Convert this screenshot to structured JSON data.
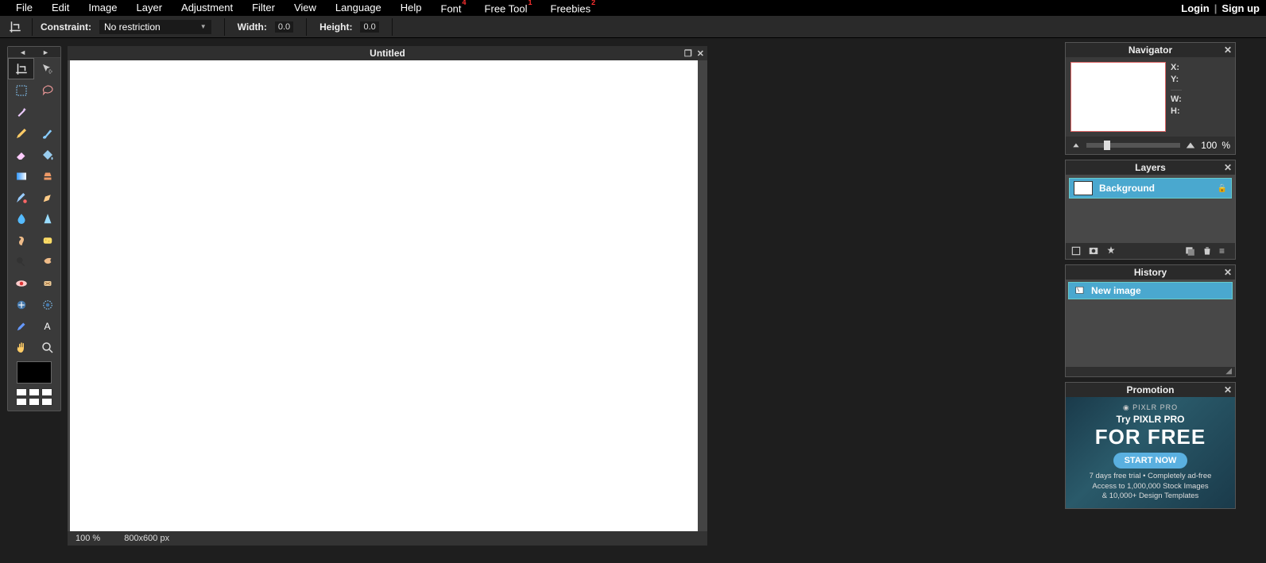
{
  "menu": {
    "items": [
      "File",
      "Edit",
      "Image",
      "Layer",
      "Adjustment",
      "Filter",
      "View",
      "Language",
      "Help",
      "Font",
      "Free Tool",
      "Freebies"
    ],
    "badges": {
      "9": "4",
      "10": "1",
      "11": "2"
    },
    "login": "Login",
    "signup": "Sign up"
  },
  "options": {
    "constraint_label": "Constraint:",
    "constraint_value": "No restriction",
    "width_label": "Width:",
    "width_value": "0.0",
    "height_label": "Height:",
    "height_value": "0.0"
  },
  "canvas": {
    "title": "Untitled",
    "zoom": "100",
    "zoom_unit": "%",
    "dimensions": "800x600 px"
  },
  "navigator": {
    "title": "Navigator",
    "x": "X:",
    "y": "Y:",
    "w": "W:",
    "h": "H:",
    "zoom": "100",
    "zoom_unit": "%"
  },
  "layers": {
    "title": "Layers",
    "items": [
      {
        "name": "Background",
        "locked": true
      }
    ]
  },
  "history": {
    "title": "History",
    "items": [
      {
        "name": "New image"
      }
    ]
  },
  "promo": {
    "title": "Promotion",
    "logo": "PIXLR PRO",
    "try": "Try PIXLR PRO",
    "free": "FOR FREE",
    "button": "START NOW",
    "line1": "7 days free trial • Completely ad-free",
    "line2": "Access to 1,000,000 Stock Images",
    "line3": "& 10,000+ Design Templates"
  },
  "tools": [
    "crop",
    "move",
    "marquee",
    "lasso",
    "wand",
    "",
    "pencil",
    "brush",
    "eraser",
    "paint-bucket",
    "gradient",
    "clone-stamp",
    "color-replace",
    "draw",
    "blur",
    "sharpen",
    "smudge",
    "sponge",
    "dodge",
    "burn",
    "redeye",
    "spot-heal",
    "bloat",
    "pinch",
    "color-picker",
    "type",
    "hand",
    "zoom"
  ]
}
